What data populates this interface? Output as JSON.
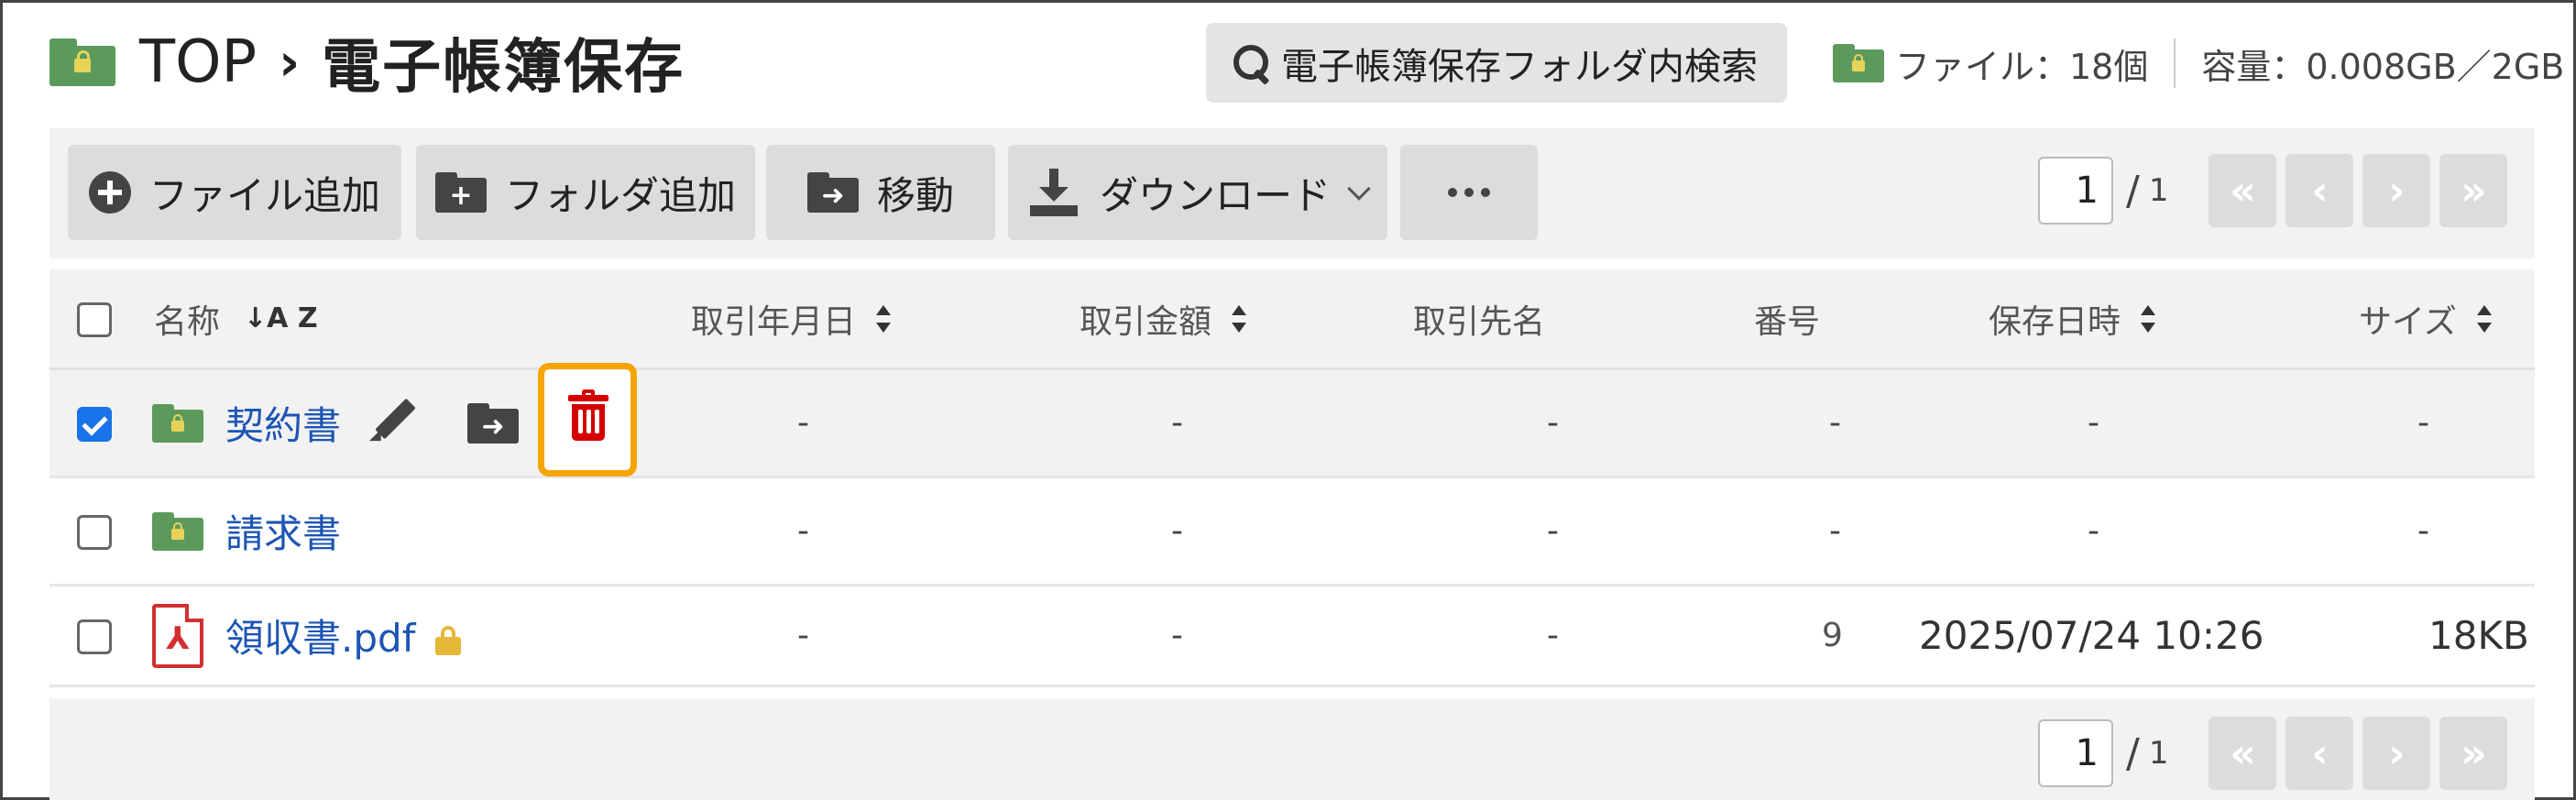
{
  "breadcrumb": {
    "root": "TOP",
    "separator": "›",
    "current": "電子帳簿保存"
  },
  "search": {
    "label": "電子帳簿保存フォルダ内検索"
  },
  "info": {
    "files": "ファイル：18個",
    "capacity": "容量：0.008GB／2GB"
  },
  "toolbar": {
    "add_file": "ファイル追加",
    "add_folder": "フォルダ追加",
    "move": "移動",
    "download": "ダウンロード",
    "more": "…"
  },
  "pagination": {
    "current": "1",
    "slash": "/",
    "total": "1",
    "first": "«",
    "prev": "‹",
    "next": "›",
    "last": "»"
  },
  "table": {
    "columns": {
      "name": "名称",
      "sort_az": "↓A Z",
      "trade_date": "取引年月日",
      "amount": "取引金額",
      "partner": "取引先名",
      "number": "番号",
      "saved_at": "保存日時",
      "size": "サイズ"
    },
    "rows": [
      {
        "name": "契約書",
        "trade_date": "-",
        "amount": "-",
        "partner": "-",
        "number": "-",
        "saved_at": "-",
        "size": "-",
        "checked": true,
        "type": "folder"
      },
      {
        "name": "請求書",
        "trade_date": "-",
        "amount": "-",
        "partner": "-",
        "number": "-",
        "saved_at": "-",
        "size": "-",
        "checked": false,
        "type": "folder"
      },
      {
        "name": "領収書.pdf",
        "trade_date": "-",
        "amount": "-",
        "partner": "-",
        "number": "9",
        "saved_at": "2025/07/24 10:26",
        "size": "18KB",
        "checked": false,
        "type": "pdf-locked"
      }
    ]
  },
  "icons": {
    "folder": "folder-lock-icon",
    "pencil": "pencil-icon",
    "move": "move-to-folder-icon",
    "trash": "trash-icon",
    "pdf": "pdf-icon",
    "lock": "lock-icon"
  },
  "colors": {
    "folder_green": "#5c9a5c",
    "link_blue": "#1c55b4",
    "trash_red": "#d40000",
    "highlight_orange": "#f5a400",
    "checkbox_blue": "#1a73e8"
  }
}
